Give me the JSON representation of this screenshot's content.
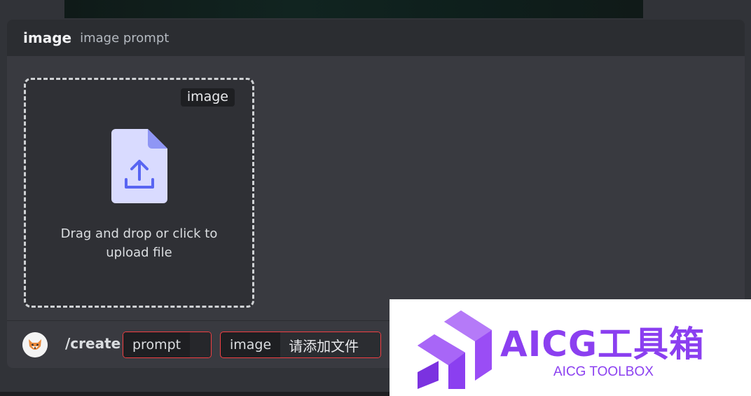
{
  "command": {
    "name": "image",
    "description": "image prompt"
  },
  "upload": {
    "tag": "image",
    "instruction": "Drag and drop or click to upload file",
    "icon": "upload-file-icon"
  },
  "command_bar": {
    "slash_command": "/create",
    "options": [
      {
        "name": "prompt",
        "value": ""
      },
      {
        "name": "image",
        "value": "请添加文件"
      }
    ]
  },
  "watermark": {
    "title": "AICG工具箱",
    "subtitle": "AICG TOOLBOX"
  },
  "colors": {
    "background": "#313338",
    "panel": "#393a40",
    "header": "#2b2d31",
    "error_border": "#f23f43",
    "upload_icon": "#5865f2",
    "brand_purple": "#8b3ff0"
  }
}
